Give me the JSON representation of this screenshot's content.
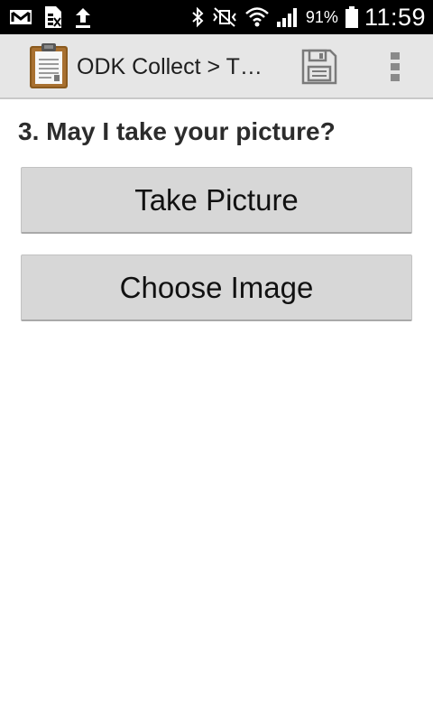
{
  "status_bar": {
    "battery_percent": "91%",
    "time": "11:59",
    "left_icons": [
      "gmail-icon",
      "sim-card-icon",
      "upload-icon"
    ],
    "right_icons": [
      "bluetooth-icon",
      "mute-vibrate-icon",
      "wifi-icon",
      "signal-icon",
      "battery-icon"
    ]
  },
  "action_bar": {
    "title": "ODK Collect > T…",
    "icons": [
      "clipboard-app-icon",
      "save-icon",
      "overflow-menu-icon"
    ],
    "background": "#e6e6e6"
  },
  "form": {
    "question": "3. May I take your picture?",
    "take_picture_label": "Take Picture",
    "choose_image_label": "Choose Image"
  }
}
